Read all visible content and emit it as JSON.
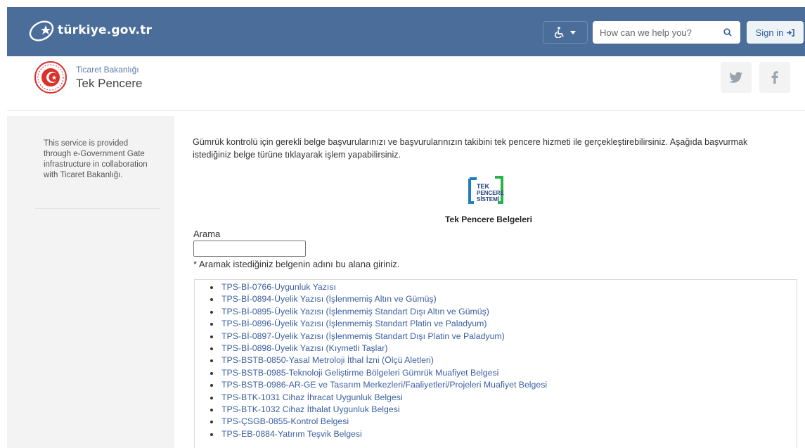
{
  "header": {
    "logo_text": "türkiye.gov.tr",
    "search_placeholder": "How can we help you?",
    "sign_in_label": "Sign in"
  },
  "subheader": {
    "ministry": "Ticaret Bakanlığı",
    "service_title": "Tek Pencere"
  },
  "sidebar": {
    "info": "This service is provided through e-Government Gate infrastructure in collaboration with Ticaret Bakanlığı."
  },
  "main": {
    "intro": "Gümrük kontrolü için gerekli belge başvurularınızı ve başvurularınızın takibini tek pencere hizmeti ile gerçekleştirebilirsiniz. Aşağıda başvurmak istediğiniz belge türüne tıklayarak işlem yapabilirsiniz.",
    "logo_lines": [
      "TEK",
      "PENCERE",
      "SİSTEMİ"
    ],
    "section_title": "Tek Pencere Belgeleri",
    "search_label": "Arama",
    "search_hint": "* Aramak istediğiniz belgenin adını bu alana giriniz.",
    "documents": [
      "TPS-Bİ-0766-Uygunluk Yazısı",
      "TPS-Bİ-0894-Üyelik Yazısı (İşlenmemiş Altın ve Gümüş)",
      "TPS-Bİ-0895-Üyelik Yazısı (İşlenmemiş Standart Dışı Altın ve Gümüş)",
      "TPS-Bİ-0896-Üyelik Yazısı (İşlenmemiş Standart Platin ve Paladyum)",
      "TPS-Bİ-0897-Üyelik Yazısı (İşlenmemiş Standart Dışı Platin ve Paladyum)",
      "TPS-Bİ-0898-Üyelik Yazısı (Kıymetli Taşlar)",
      "TPS-BSTB-0850-Yasal Metroloji İthal İzni (Ölçü Aletleri)",
      "TPS-BSTB-0985-Teknoloji Geliştirme Bölgeleri Gümrük Muafiyet Belgesi",
      "TPS-BSTB-0986-AR-GE ve Tasarım Merkezleri/Faaliyetleri/Projeleri Muafiyet Belgesi",
      "TPS-BTK-1031 Cihaz İhracat Uygunluk Belgesi",
      "TPS-BTK-1032 Cihaz İthalat Uygunluk Belgesi",
      "TPS-ÇSGB-0855-Kontrol Belgesi",
      "TPS-EB-0884-Yatırım Teşvik Belgesi"
    ]
  }
}
